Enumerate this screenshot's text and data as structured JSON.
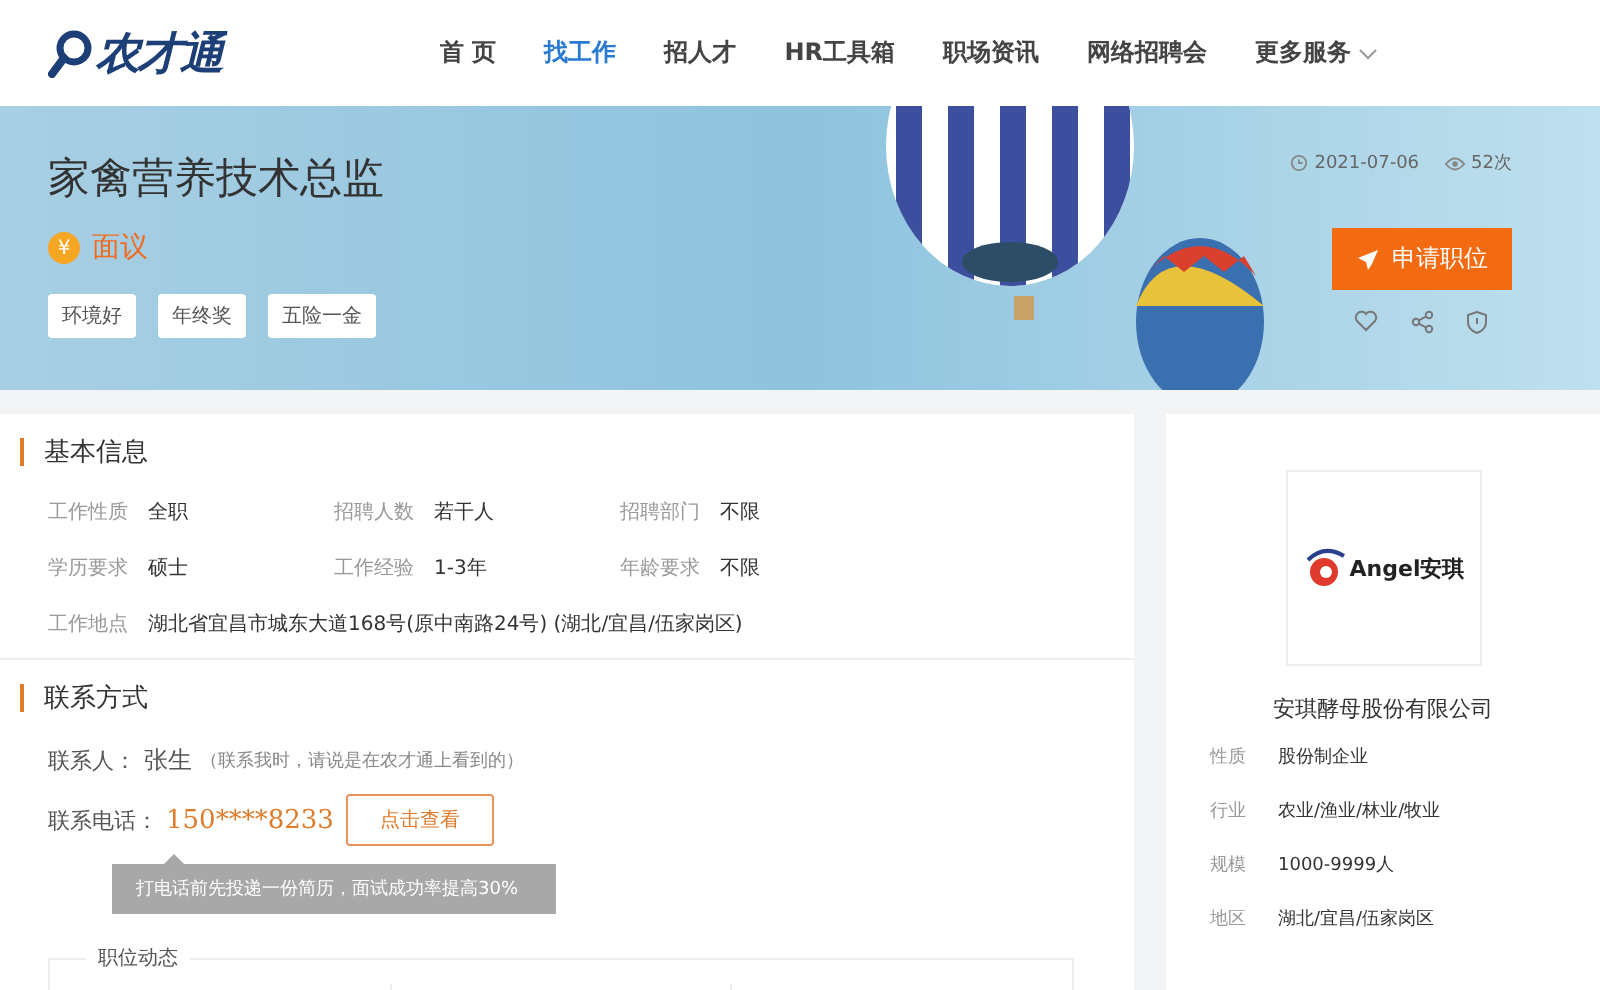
{
  "header": {
    "logo_text": "农才通",
    "nav": [
      {
        "label": "首 页",
        "selected": false
      },
      {
        "label": "找工作",
        "selected": true
      },
      {
        "label": "招人才",
        "selected": false
      },
      {
        "label": "HR工具箱",
        "selected": false
      },
      {
        "label": "职场资讯",
        "selected": false
      },
      {
        "label": "网络招聘会",
        "selected": false
      },
      {
        "label": "更多服务",
        "selected": false,
        "kind": "dropdown"
      }
    ]
  },
  "job": {
    "title": "家禽营养技术总监",
    "salary_icon": "¥",
    "salary": "面议",
    "tags": [
      "环境好",
      "年终奖",
      "五险一金"
    ],
    "date": "2021-07-06",
    "views": "52次",
    "apply_button": "申请职位"
  },
  "basic_info": {
    "title": "基本信息",
    "fields": [
      {
        "label": "工作性质",
        "value": "全职"
      },
      {
        "label": "招聘人数",
        "value": "若干人"
      },
      {
        "label": "招聘部门",
        "value": "不限"
      },
      {
        "label": "学历要求",
        "value": "硕士"
      },
      {
        "label": "工作经验",
        "value": "1-3年"
      },
      {
        "label": "年龄要求",
        "value": "不限"
      },
      {
        "label": "工作地点",
        "value": "湖北省宜昌市城东大道168号(原中南路24号) (湖北/宜昌/伍家岗区)",
        "kind": "wide"
      }
    ]
  },
  "contact": {
    "title": "联系方式",
    "person_label": "联系人：",
    "person": "张生",
    "person_note": "（联系我时，请说是在农才通上看到的）",
    "phone_label": "联系电话：",
    "phone": "150****8233",
    "reveal_button": "点击查看",
    "tooltip": "打电话前先投递一份简历，面试成功率提高30%",
    "stats_title": "职位动态"
  },
  "company": {
    "logo_text": "Angel安琪",
    "name": "安琪酵母股份有限公司",
    "fields": [
      {
        "label": "性质",
        "value": "股份制企业"
      },
      {
        "label": "行业",
        "value": "农业/渔业/林业/牧业"
      },
      {
        "label": "规模",
        "value": "1000-9999人"
      },
      {
        "label": "地区",
        "value": "湖北/宜昌/伍家岗区"
      }
    ]
  }
}
